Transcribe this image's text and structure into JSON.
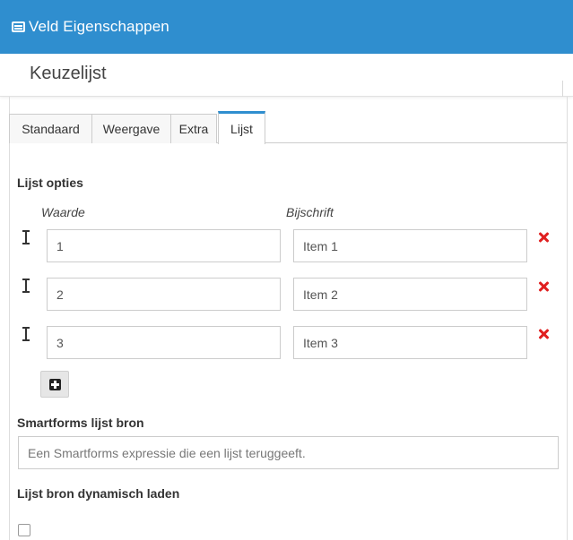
{
  "window": {
    "title": "Veld Eigenschappen",
    "icon": "list-window-icon"
  },
  "subheader": {
    "title": "Keuzelijst"
  },
  "tabs": [
    {
      "label": "Standaard",
      "active": false
    },
    {
      "label": "Weergave",
      "active": false
    },
    {
      "label": "Extra",
      "active": false
    },
    {
      "label": "Lijst",
      "active": true
    }
  ],
  "options_section": {
    "label": "Lijst opties",
    "value_column": "Waarde",
    "caption_column": "Bijschrift",
    "rows": [
      {
        "value": "1",
        "caption": "Item 1"
      },
      {
        "value": "2",
        "caption": "Item 2"
      },
      {
        "value": "3",
        "caption": "Item 3"
      }
    ]
  },
  "source_section": {
    "label": "Smartforms lijst bron",
    "placeholder": "Een Smartforms expressie die een lijst teruggeeft.",
    "value": ""
  },
  "dynamic_section": {
    "label": "Lijst bron dynamisch laden",
    "checked": false
  },
  "colors": {
    "accent": "#2f8ecf",
    "remove": "#e02020"
  }
}
